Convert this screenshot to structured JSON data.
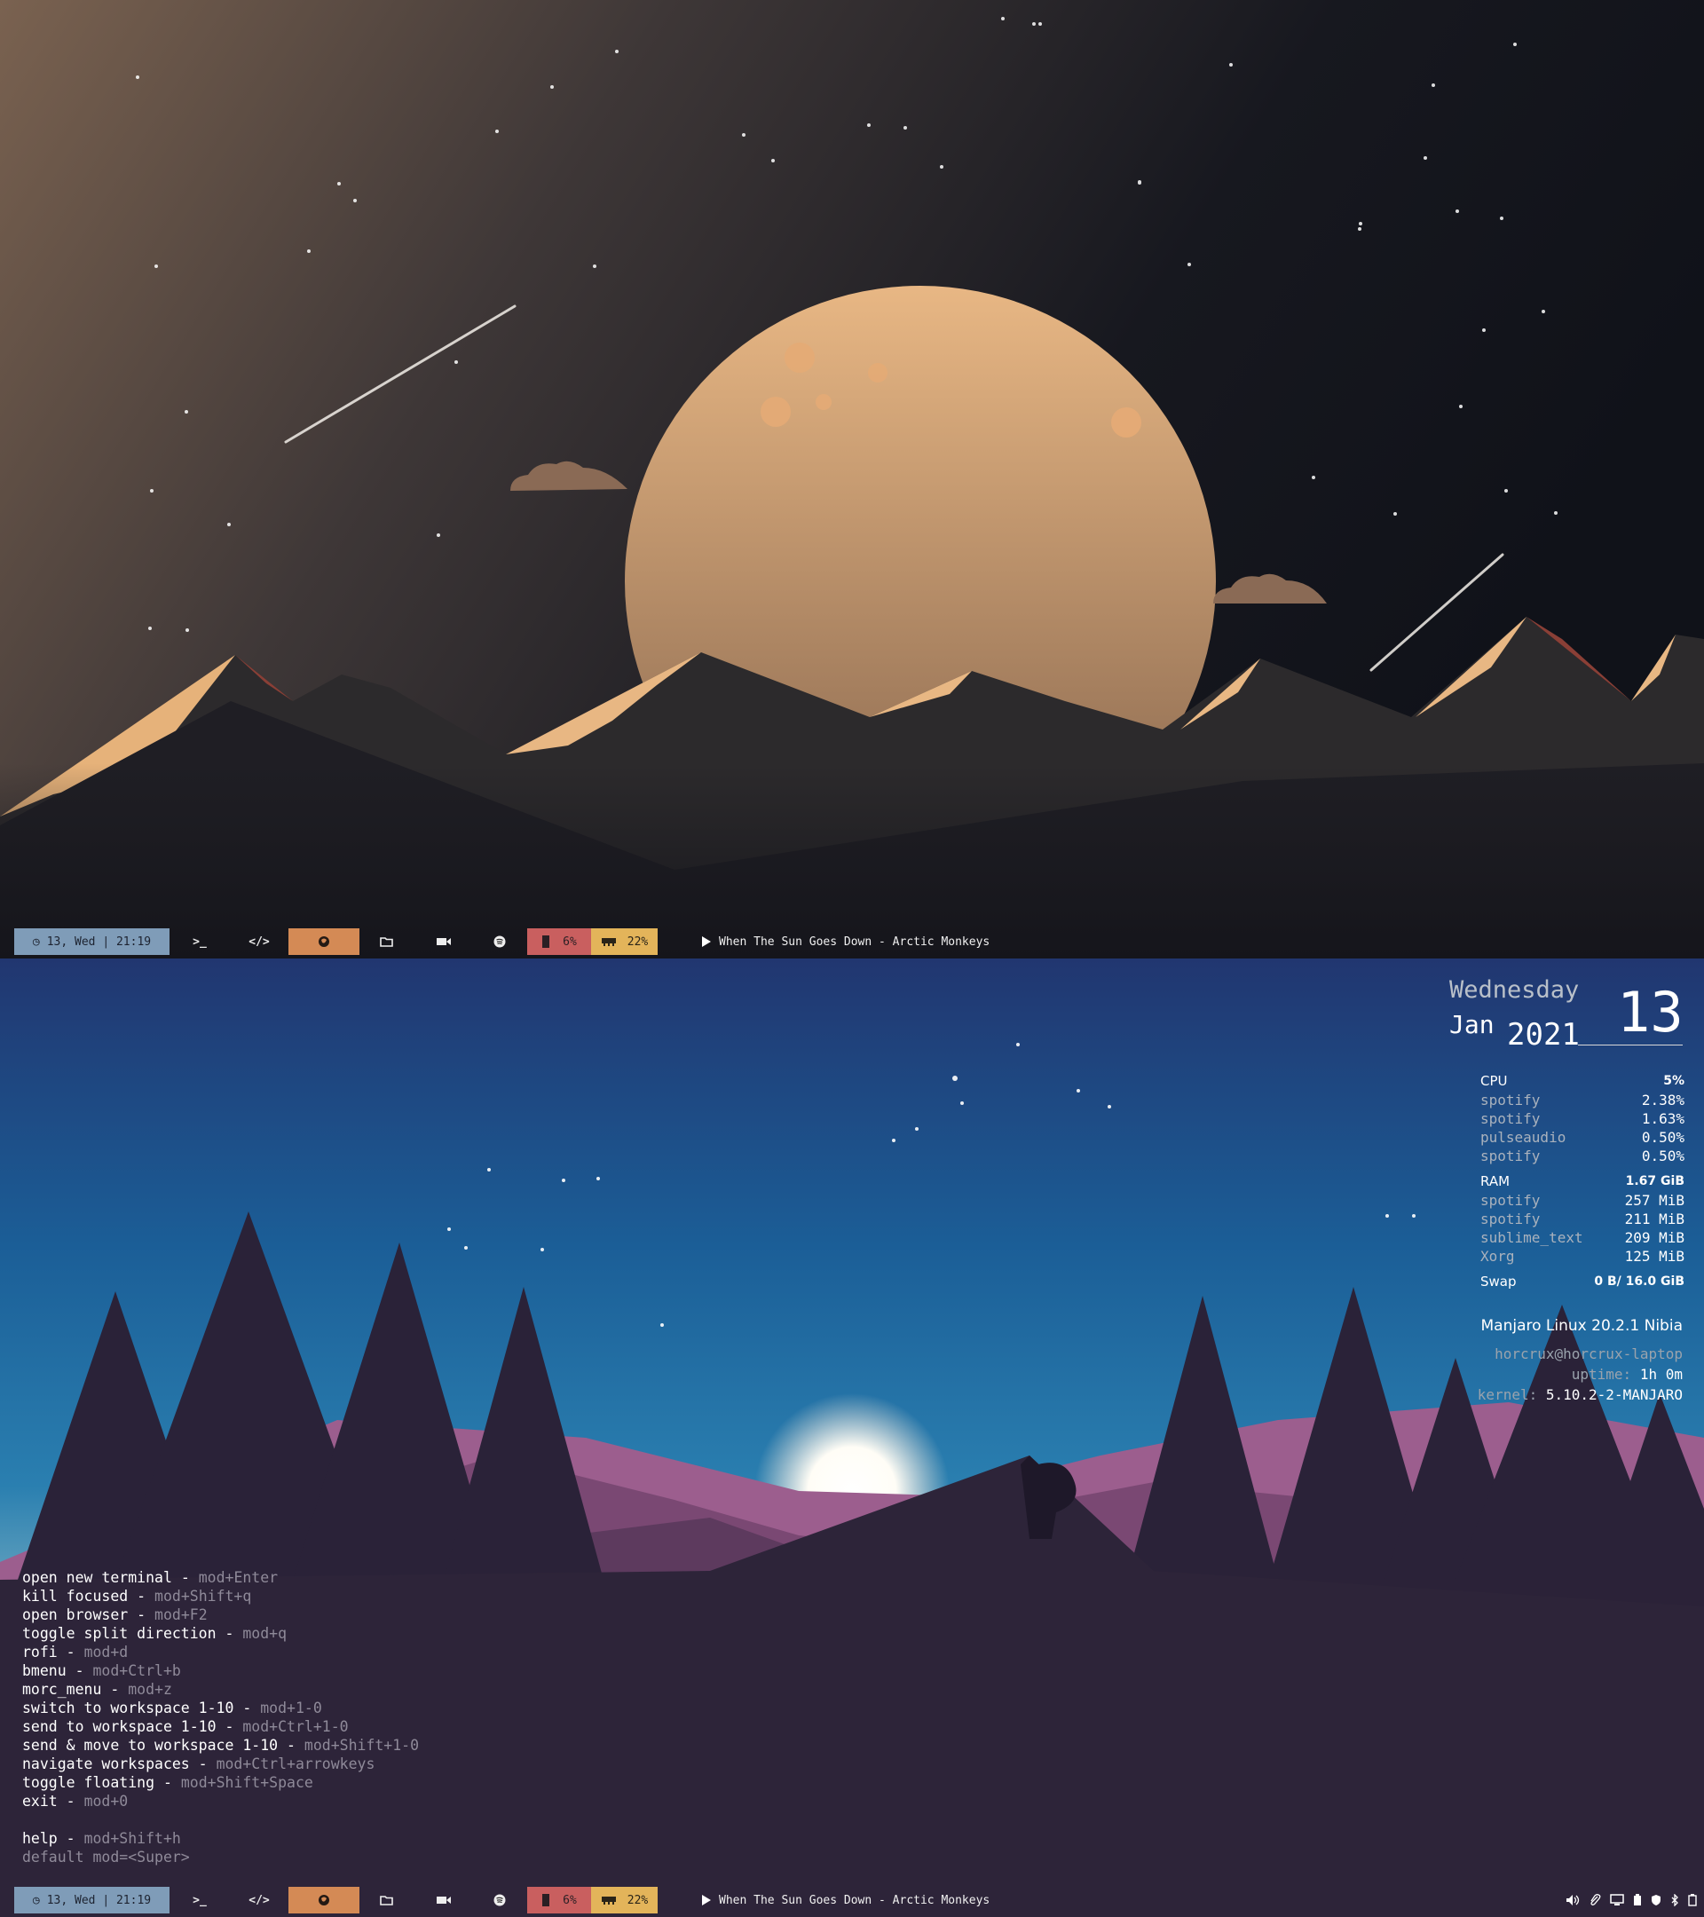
{
  "polybar": {
    "date": "13, Wed | 21:19",
    "cpu_percent": "6%",
    "mem_percent": "22%",
    "now_playing": "When The Sun Goes Down - Arctic Monkeys",
    "icons": [
      "clock-icon",
      "terminal-icon",
      "code-icon",
      "firefox-icon",
      "folder-icon",
      "video-icon",
      "spotify-icon",
      "cpu-icon",
      "memory-icon",
      "play-icon"
    ],
    "colors": {
      "date_bg": "#7f9cb8",
      "firefox_bg": "#d48a55",
      "cpu_bg": "#c95f5f",
      "mem_bg": "#e3b45a"
    }
  },
  "tray": {
    "icons": [
      "volume-icon",
      "attachment-icon",
      "monitor-icon",
      "battery-icon",
      "shield-icon",
      "bluetooth-icon",
      "battery-full-icon"
    ]
  },
  "conky": {
    "weekday": "Wednesday",
    "month": "Jan",
    "year": "2021",
    "day": "13",
    "cpu": {
      "label": "CPU",
      "total": "5%",
      "processes": [
        {
          "name": "spotify",
          "value": "2.38%"
        },
        {
          "name": "spotify",
          "value": "1.63%"
        },
        {
          "name": "pulseaudio",
          "value": "0.50%"
        },
        {
          "name": "spotify",
          "value": "0.50%"
        }
      ]
    },
    "ram": {
      "label": "RAM",
      "total": "1.67 GiB",
      "processes": [
        {
          "name": "spotify",
          "value": "257 MiB"
        },
        {
          "name": "spotify",
          "value": "211 MiB"
        },
        {
          "name": "sublime_text",
          "value": "209 MiB"
        },
        {
          "name": "Xorg",
          "value": "125 MiB"
        }
      ]
    },
    "swap": {
      "label": "Swap",
      "value": "0 B/ 16.0 GiB"
    },
    "os": "Manjaro Linux 20.2.1 Nibia",
    "host": "horcrux@horcrux-laptop",
    "uptime_label": "uptime:",
    "uptime": "1h 0m",
    "kernel_label": "kernel:",
    "kernel": "5.10.2-2-MANJARO"
  },
  "keybinds": [
    {
      "action": "open new terminal",
      "key": "mod+Enter"
    },
    {
      "action": "kill focused",
      "key": "mod+Shift+q"
    },
    {
      "action": "open browser",
      "key": "mod+F2"
    },
    {
      "action": "toggle split direction",
      "key": "mod+q"
    },
    {
      "action": "rofi",
      "key": "mod+d"
    },
    {
      "action": "bmenu",
      "key": "mod+Ctrl+b"
    },
    {
      "action": "morc_menu",
      "key": "mod+z"
    },
    {
      "action": "switch to workspace 1-10",
      "key": "mod+1-0"
    },
    {
      "action": "send to workspace 1-10",
      "key": "mod+Ctrl+1-0"
    },
    {
      "action": "send & move to workspace 1-10",
      "key": "mod+Shift+1-0"
    },
    {
      "action": "navigate workspaces",
      "key": "mod+Ctrl+arrowkeys"
    },
    {
      "action": "toggle floating",
      "key": "mod+Shift+Space"
    },
    {
      "action": "exit",
      "key": "mod+0"
    }
  ],
  "help": {
    "action": "help",
    "key": "mod+Shift+h",
    "note": "default mod=<Super>"
  }
}
